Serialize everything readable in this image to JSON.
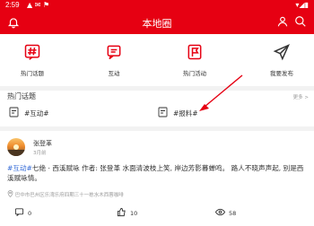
{
  "status_bar": {
    "time": "2:59",
    "left_icons": "▲ ✉ ⚑",
    "right_icons": "▾◢▮"
  },
  "header": {
    "title": "本地圈",
    "accent": "#e60012"
  },
  "quick_actions": [
    {
      "label": "热门话题",
      "icon": "hashtag-icon"
    },
    {
      "label": "互动",
      "icon": "chat-icon"
    },
    {
      "label": "热门活动",
      "icon": "flag-icon"
    },
    {
      "label": "我要发布",
      "icon": "send-icon"
    }
  ],
  "hot_topics": {
    "title": "热门话题",
    "more": "更多 >",
    "items": [
      {
        "label": "#互动#"
      },
      {
        "label": "#报料#"
      }
    ]
  },
  "post": {
    "author": "张登革",
    "time": "3月前",
    "tag": "#互动#",
    "body": "七绝 · 西溪赋咏 作者: 张登革 水面清波枝上笑, 岸边芳影暮蝉鸣。 路人不晓声声起, 别是西溪赋咏情。",
    "location": "巴中市巴州区乐湾乐府四期三十一栋水木西蓉咖啡",
    "comments": "0",
    "likes": "10",
    "views": "58"
  }
}
